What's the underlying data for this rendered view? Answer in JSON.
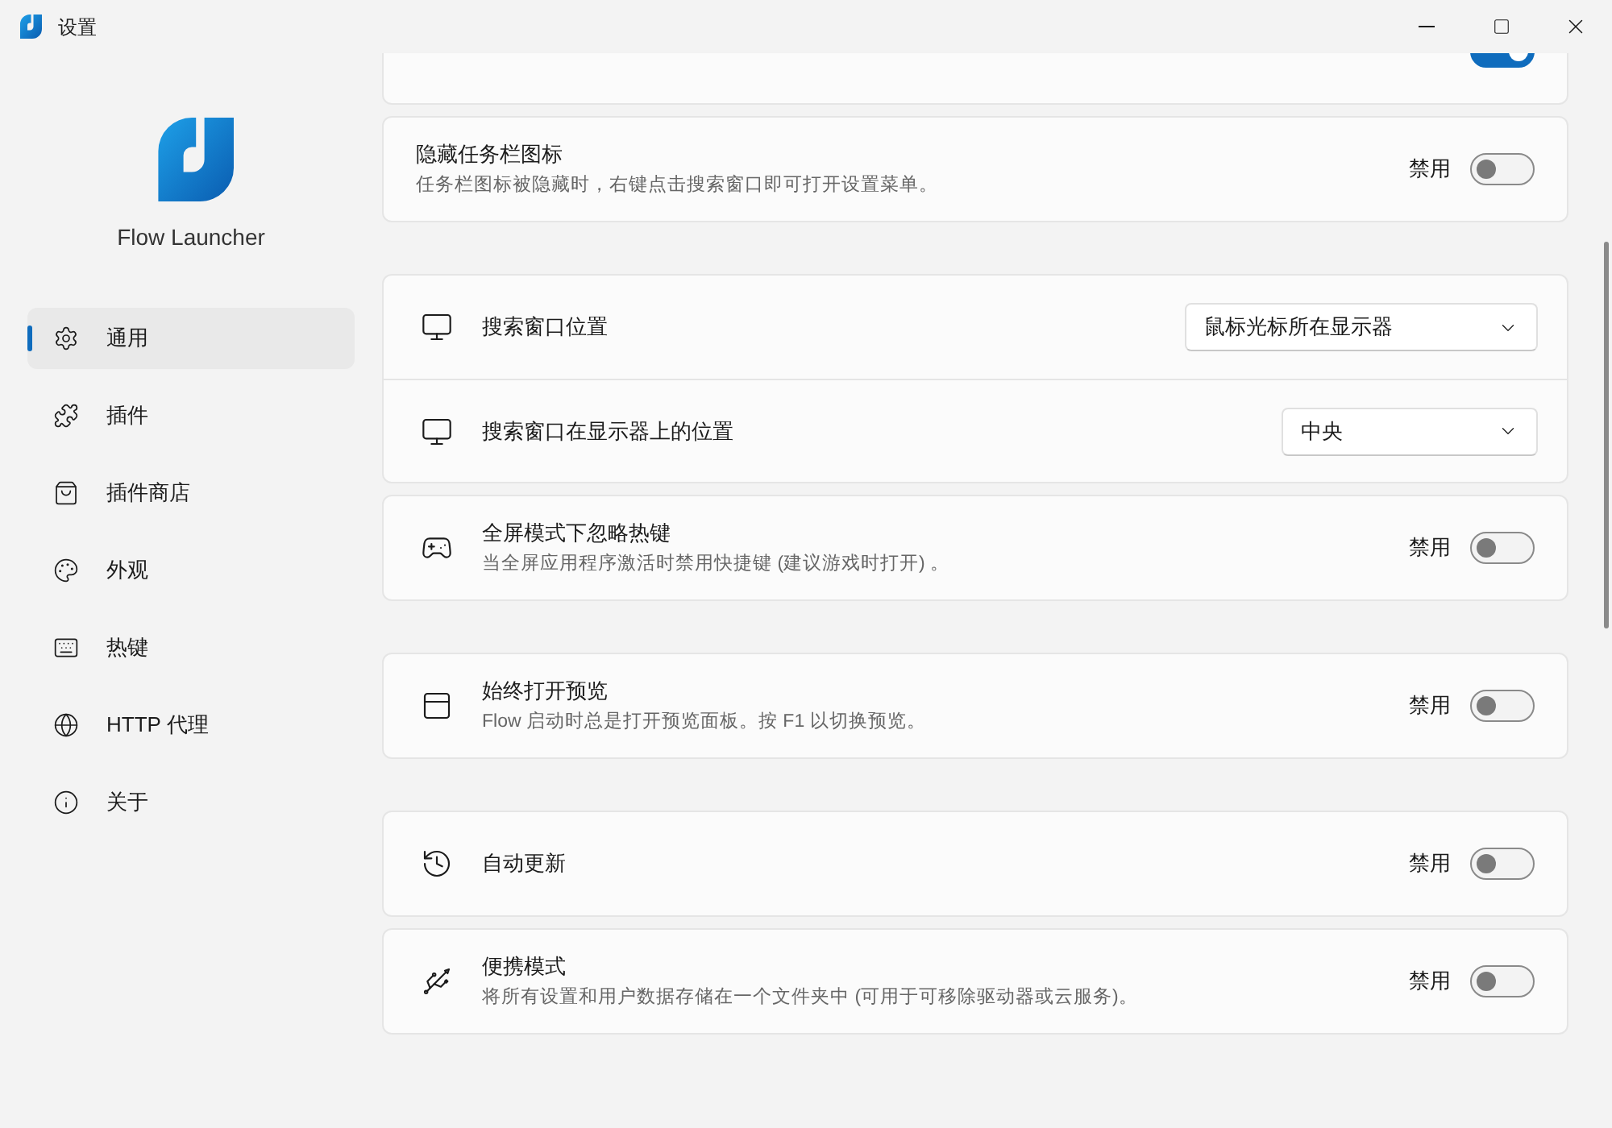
{
  "window": {
    "title": "设置"
  },
  "sidebar": {
    "app_name": "Flow Launcher",
    "items": [
      {
        "label": "通用",
        "selected": true
      },
      {
        "label": "插件",
        "selected": false
      },
      {
        "label": "插件商店",
        "selected": false
      },
      {
        "label": "外观",
        "selected": false
      },
      {
        "label": "热键",
        "selected": false
      },
      {
        "label": "HTTP 代理",
        "selected": false
      },
      {
        "label": "关于",
        "selected": false
      }
    ]
  },
  "sections": [
    {
      "cards": [
        {
          "rows": [
            {
              "kind": "toggle",
              "on": true
            }
          ]
        },
        {
          "rows": [
            {
              "kind": "toggle",
              "title": "隐藏任务栏图标",
              "description": "任务栏图标被隐藏时，右键点击搜索窗口即可打开设置菜单。",
              "state_label": "禁用",
              "on": false
            }
          ]
        }
      ]
    },
    {
      "cards": [
        {
          "rows": [
            {
              "kind": "dropdown",
              "title": "搜索窗口位置",
              "value": "鼠标光标所在显示器",
              "wide": true
            },
            {
              "kind": "dropdown",
              "title": "搜索窗口在显示器上的位置",
              "value": "中央",
              "wide": false
            }
          ]
        },
        {
          "rows": [
            {
              "kind": "toggle",
              "title": "全屏模式下忽略热键",
              "description": "当全屏应用程序激活时禁用快捷键 (建议游戏时打开) 。",
              "state_label": "禁用",
              "on": false
            }
          ]
        }
      ]
    },
    {
      "cards": [
        {
          "rows": [
            {
              "kind": "toggle",
              "title": "始终打开预览",
              "description": "Flow 启动时总是打开预览面板。按 F1 以切换预览。",
              "state_label": "禁用",
              "on": false
            }
          ]
        }
      ]
    },
    {
      "cards": [
        {
          "rows": [
            {
              "kind": "toggle",
              "title": "自动更新",
              "state_label": "禁用",
              "on": false
            }
          ]
        },
        {
          "rows": [
            {
              "kind": "toggle",
              "title": "便携模式",
              "description": "将所有设置和用户数据存储在一个文件夹中 (可用于可移除驱动器或云服务)。",
              "state_label": "禁用",
              "on": false
            }
          ]
        }
      ]
    }
  ]
}
